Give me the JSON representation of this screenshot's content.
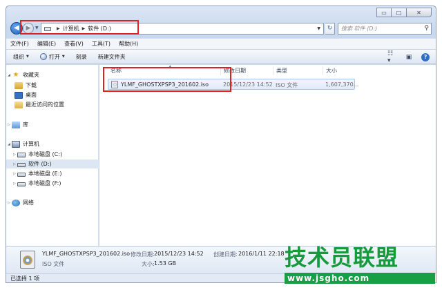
{
  "window": {
    "minimize_label": "▭",
    "maximize_label": "□",
    "close_label": "✕"
  },
  "address": {
    "back_label": "◀",
    "forward_label": "▶",
    "crumbs": [
      "计算机",
      "软件 (D:)"
    ],
    "search_placeholder": "搜索 软件 (D:)",
    "refresh_label": "↻"
  },
  "menu": [
    "文件(F)",
    "编辑(E)",
    "查看(V)",
    "工具(T)",
    "帮助(H)"
  ],
  "commands": {
    "organize": "组织",
    "open": "打开",
    "burn": "刻录",
    "new_folder": "新建文件夹"
  },
  "nav": {
    "favorites": "收藏夹",
    "downloads": "下载",
    "desktop": "桌面",
    "recent": "最近访问的位置",
    "libraries": "库",
    "computer": "计算机",
    "drive_c": "本地磁盘 (C:)",
    "drive_d": "软件 (D:)",
    "drive_e": "本地磁盘 (E:)",
    "drive_f": "本地磁盘 (F:)",
    "network": "网络"
  },
  "columns": [
    "名称",
    "修改日期",
    "类型",
    "大小"
  ],
  "files": [
    {
      "name": "YLMF_GHOSTXPSP3_201602.iso",
      "modified": "2015/12/23 14:52",
      "type": "ISO 文件",
      "size": "1,607,370..."
    }
  ],
  "details": {
    "name": "YLMF_GHOSTXPSP3_201602.iso",
    "type": "ISO 文件",
    "modified_label": "修改日期:",
    "modified_value": "2015/12/23 14:52",
    "size_label": "大小:",
    "size_value": "1.53 GB",
    "created_label": "创建日期:",
    "created_value": "2016/1/11 22:18"
  },
  "status": "已选择 1 项",
  "watermark": {
    "title": "技术员联盟",
    "url": "www.jsgho.com"
  },
  "colors": {
    "highlight": "#e02020",
    "watermark_green": "#159a3c"
  }
}
